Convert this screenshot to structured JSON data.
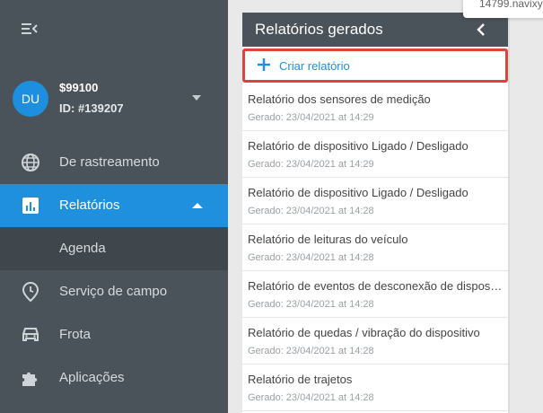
{
  "sidebar": {
    "user": {
      "initials": "DU",
      "name": "$99100",
      "id": "ID: #139207"
    },
    "items": [
      {
        "label": "De rastreamento",
        "icon": "globe-icon"
      },
      {
        "label": "Relatórios",
        "icon": "bar-chart-icon"
      },
      {
        "label": "Agenda",
        "icon": ""
      },
      {
        "label": "Serviço de campo",
        "icon": "location-pin-icon"
      },
      {
        "label": "Frota",
        "icon": "car-icon"
      },
      {
        "label": "Aplicações",
        "icon": "puzzle-icon"
      }
    ]
  },
  "panel": {
    "title": "Relatórios gerados",
    "create_label": "Criar relatório",
    "reports": [
      {
        "title": "Relatório dos sensores de medição",
        "date": "Gerado: 23/04/2021 at 14:29"
      },
      {
        "title": "Relatório de dispositivo Ligado / Desligado",
        "date": "Gerado: 23/04/2021 at 14:29"
      },
      {
        "title": "Relatório de dispositivo Ligado / Desligado",
        "date": "Gerado: 23/04/2021 at 14:28"
      },
      {
        "title": "Relatório de leituras do veículo",
        "date": "Gerado: 23/04/2021 at 14:28"
      },
      {
        "title": "Relatório de eventos de desconexão de dispositivo",
        "date": "Gerado: 23/04/2021 at 14:28"
      },
      {
        "title": "Relatório de quedas / vibração do dispositivo",
        "date": "Gerado: 23/04/2021 at 14:28"
      },
      {
        "title": "Relatório de trajetos",
        "date": "Gerado: 23/04/2021 at 14:28"
      }
    ]
  },
  "tooltip": {
    "text": "14799.navixy"
  },
  "colors": {
    "accent": "#1e90dd",
    "sidebar": "#4a5359",
    "highlight": "#e0413a"
  }
}
